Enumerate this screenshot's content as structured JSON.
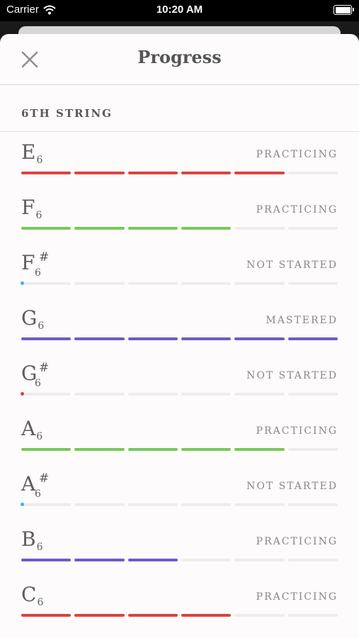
{
  "statusbar": {
    "carrier": "Carrier",
    "time": "10:20 AM"
  },
  "nav": {
    "title": "Progress"
  },
  "section": {
    "label": "6TH STRING"
  },
  "colors": {
    "red": "#d9453f",
    "green": "#78c85a",
    "purple": "#6d5cc6",
    "blue_dot": "#3fb3e5",
    "red_dot": "#d9453f"
  },
  "rows": [
    {
      "letter": "E",
      "sharp": false,
      "octave": "6",
      "status": "PRACTICING",
      "color": "red",
      "progress": "5/6"
    },
    {
      "letter": "F",
      "sharp": false,
      "octave": "6",
      "status": "PRACTICING",
      "color": "green",
      "progress": "4/6"
    },
    {
      "letter": "F",
      "sharp": true,
      "accidental": "#",
      "octave": "6",
      "status": "NOT STARTED",
      "dot": "blue_dot",
      "progress": "0/6"
    },
    {
      "letter": "G",
      "sharp": false,
      "octave": "6",
      "status": "MASTERED",
      "color": "purple",
      "progress": "6/6"
    },
    {
      "letter": "G",
      "sharp": true,
      "accidental": "#",
      "octave": "6",
      "status": "NOT STARTED",
      "dot": "red_dot",
      "progress": "0/6"
    },
    {
      "letter": "A",
      "sharp": false,
      "octave": "6",
      "status": "PRACTICING",
      "color": "green",
      "progress": "5/6"
    },
    {
      "letter": "A",
      "sharp": true,
      "accidental": "#",
      "octave": "6",
      "status": "NOT STARTED",
      "dot": "blue_dot",
      "progress": "0/6"
    },
    {
      "letter": "B",
      "sharp": false,
      "octave": "6",
      "status": "PRACTICING",
      "color": "purple",
      "progress": "3/6"
    },
    {
      "letter": "C",
      "sharp": false,
      "octave": "6",
      "status": "PRACTICING",
      "color": "red",
      "progress": "4/6"
    }
  ]
}
